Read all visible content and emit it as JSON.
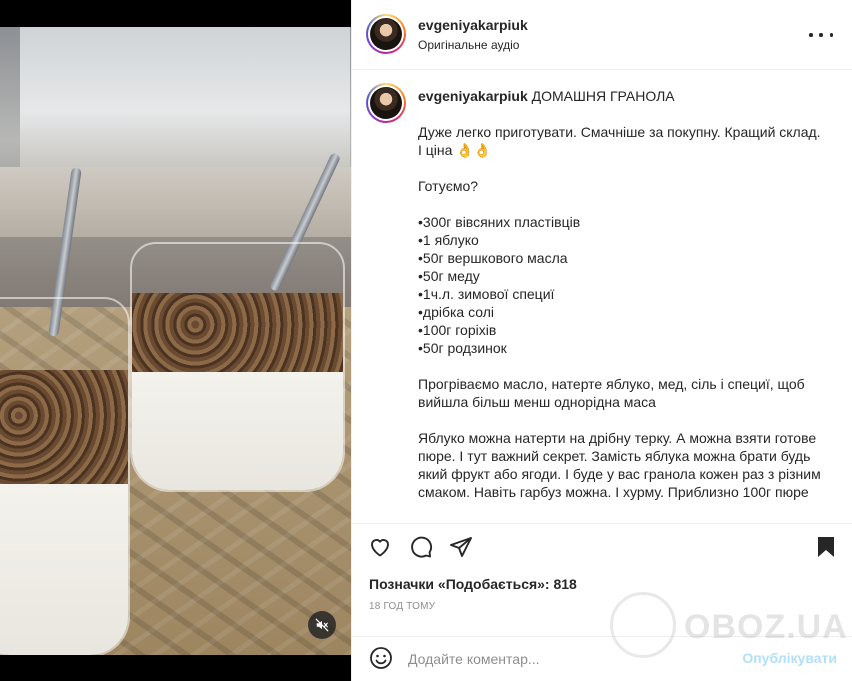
{
  "header": {
    "username": "evgeniyakarpiuk",
    "audio": "Оригінальне аудіо"
  },
  "caption": {
    "username": "evgeniyakarpiuk",
    "title": "ДОМАШНЯ ГРАНОЛА",
    "body": "Дуже легко приготувати. Смачніше за покупну. Кращий склад.\nІ ціна 👌👌\n\nГотуємо?\n\n•300г вівсяних пластівців\n•1 яблуко\n•50г вершкового масла\n•50г меду\n•1ч.л. зимової специї\n•дрібка солі\n•100г горіхів\n•50г родзинок\n\nПрогріваємо масло, натерте яблуко, мед, сіль і специї, щоб\nвийшла більш менш однорідна маса\n\nЯблуко можна натерти на дрібну терку. А можна взяти готове\nпюре. І тут важний секрет. Замість яблука можна брати будь\nякий фрукт або ягоди. І буде у вас гранола кожен раз з різним\nсмаком. Навіть гарбуз можна. І хурму. Приблизно 100г пюре"
  },
  "likes": "Позначки «Подобається»: 818",
  "time": "18 ГОД ТОМУ",
  "comment": {
    "placeholder": "Додайте коментар...",
    "publish": "Опублікувати"
  },
  "watermark": "OBOZ.UA",
  "icons": {
    "like": "heart-icon",
    "comment": "comment-icon",
    "share": "share-icon",
    "save": "bookmark-icon",
    "mute": "muted-speaker-icon",
    "emoji": "smiley-icon",
    "more": "more-options-icon"
  },
  "colors": {
    "publish": "#b2dffc",
    "muted_text": "#8e8e8e",
    "text": "#262626"
  }
}
